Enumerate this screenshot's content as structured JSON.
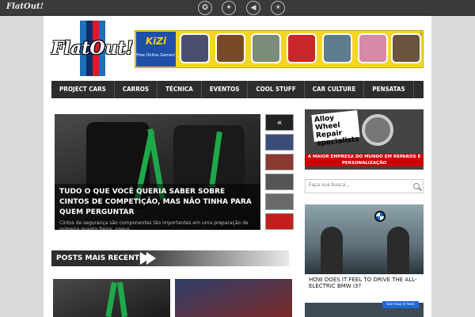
{
  "topbar": {
    "logo_text": "FlatOut!",
    "icons": [
      "emblem-icon",
      "badge-icon",
      "megaphone-icon",
      "lightbulb-icon"
    ]
  },
  "header": {
    "logo_text": "FlatOut!"
  },
  "ad_banner": {
    "brand": "KiZi",
    "tagline": "Free Online Games!",
    "close": "i"
  },
  "nav": {
    "items": [
      "PROJECT CARS",
      "CARROS",
      "TÉCNICA",
      "EVENTOS",
      "COOL STUFF",
      "CAR CULTURE",
      "PENSATAS"
    ]
  },
  "hero": {
    "title": "TUDO O QUE VOCÊ QUERIA SABER SOBRE CINTOS DE COMPETIÇÃO, MAS NÃO TINHA PARA QUEM PERGUNTAR",
    "excerpt": "Cintos de segurança são componentes tão importantes em uma preparação de primeira quanto freios, pneus,"
  },
  "thumbs": {
    "arrow": "«"
  },
  "side_ad": {
    "brand": "Alloy Wheel Repair specialists",
    "bar": "A MAIOR EMPRESA DO MUNDO EM REPAROS E PERSONALIZAÇÃO"
  },
  "search": {
    "placeholder": "Faça sua busca..."
  },
  "video_ad": {
    "headline": "HOW DOES IT FEEL TO DRIVE THE ALL-ELECTRIC BMW i3?",
    "button": "See how it feels"
  },
  "section": {
    "title": "POSTS MAIS RECENTES"
  },
  "colors": {
    "accent": "#1fa84a",
    "nav": "#2d2d2d",
    "ad_yellow": "#f3d625"
  }
}
